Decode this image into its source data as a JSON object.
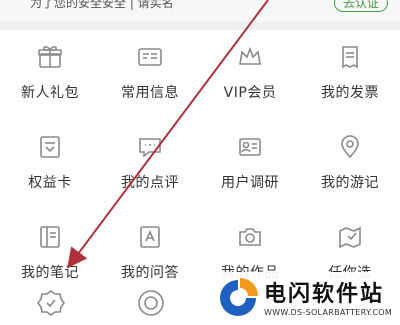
{
  "banner": {
    "text": "为了您的安全安全 | 请实名",
    "link": "去认证"
  },
  "grid": {
    "items": [
      {
        "label": "新人礼包",
        "icon": "gift-icon"
      },
      {
        "label": "常用信息",
        "icon": "id-card-icon"
      },
      {
        "label": "VIP会员",
        "icon": "crown-icon"
      },
      {
        "label": "我的发票",
        "icon": "invoice-icon"
      },
      {
        "label": "权益卡",
        "icon": "card-icon"
      },
      {
        "label": "我的点评",
        "icon": "comment-icon"
      },
      {
        "label": "用户调研",
        "icon": "survey-icon"
      },
      {
        "label": "我的游记",
        "icon": "location-pin-icon"
      },
      {
        "label": "我的笔记",
        "icon": "notebook-icon"
      },
      {
        "label": "我的问答",
        "icon": "qa-icon"
      },
      {
        "label": "我的作品",
        "icon": "camera-icon"
      },
      {
        "label": "任你选",
        "icon": "map-icon"
      }
    ],
    "partial_icons": [
      "badge-icon",
      "coupon-icon"
    ]
  },
  "watermark": {
    "title": "电闪软件站",
    "url": "WWW.DS-SOLARBATTERY.COM",
    "colors": {
      "blue": "#1f5fbf",
      "orange": "#f39a1e"
    }
  },
  "colors": {
    "icon_stroke": "#8a8a8a",
    "label": "#333333",
    "arrow": "#b0303a",
    "background": "#efefef"
  }
}
